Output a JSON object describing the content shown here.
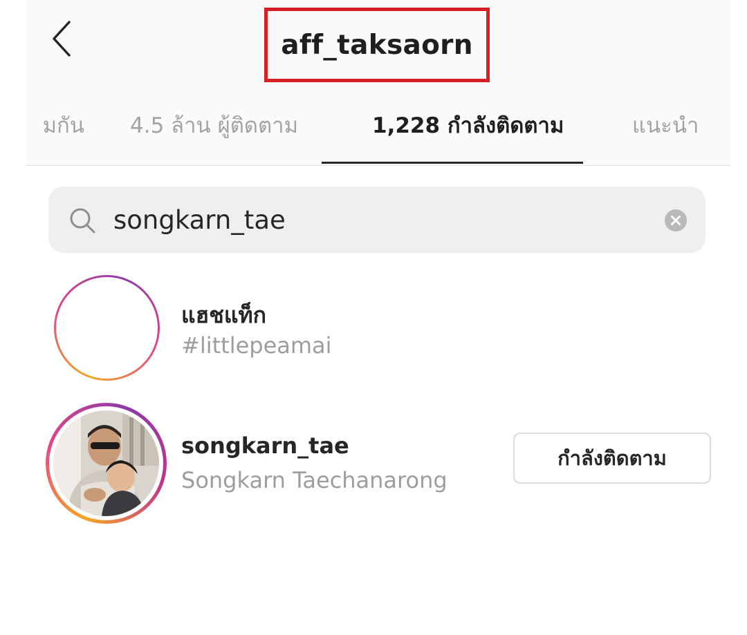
{
  "header": {
    "title": "aff_taksaorn",
    "highlight_color": "#d81f26"
  },
  "tabs": [
    {
      "label": "มกัน",
      "active": false
    },
    {
      "label": "4.5 ล้าน ผู้ติดตาม",
      "active": false
    },
    {
      "label": "1,228 กำลังติดตาม",
      "active": true
    },
    {
      "label": "แนะนำ",
      "active": false
    }
  ],
  "search": {
    "value": "songkarn_tae",
    "icon": "search-icon",
    "clear_icon": "clear-icon"
  },
  "results": [
    {
      "type": "hashtag",
      "title": "แฮชแท็ก",
      "subtitle": "#littlepeamai",
      "icon": "hashtag-icon"
    },
    {
      "type": "user",
      "title": "songkarn_tae",
      "subtitle": "Songkarn Taechanarong",
      "button_label": "กำลังติดตาม"
    }
  ],
  "colors": {
    "story_ring_start": "#f5a623",
    "story_ring_mid": "#e0468a",
    "story_ring_end": "#8e3aa8",
    "secondary_text": "#9d9d9d",
    "search_bg": "#efefef"
  }
}
